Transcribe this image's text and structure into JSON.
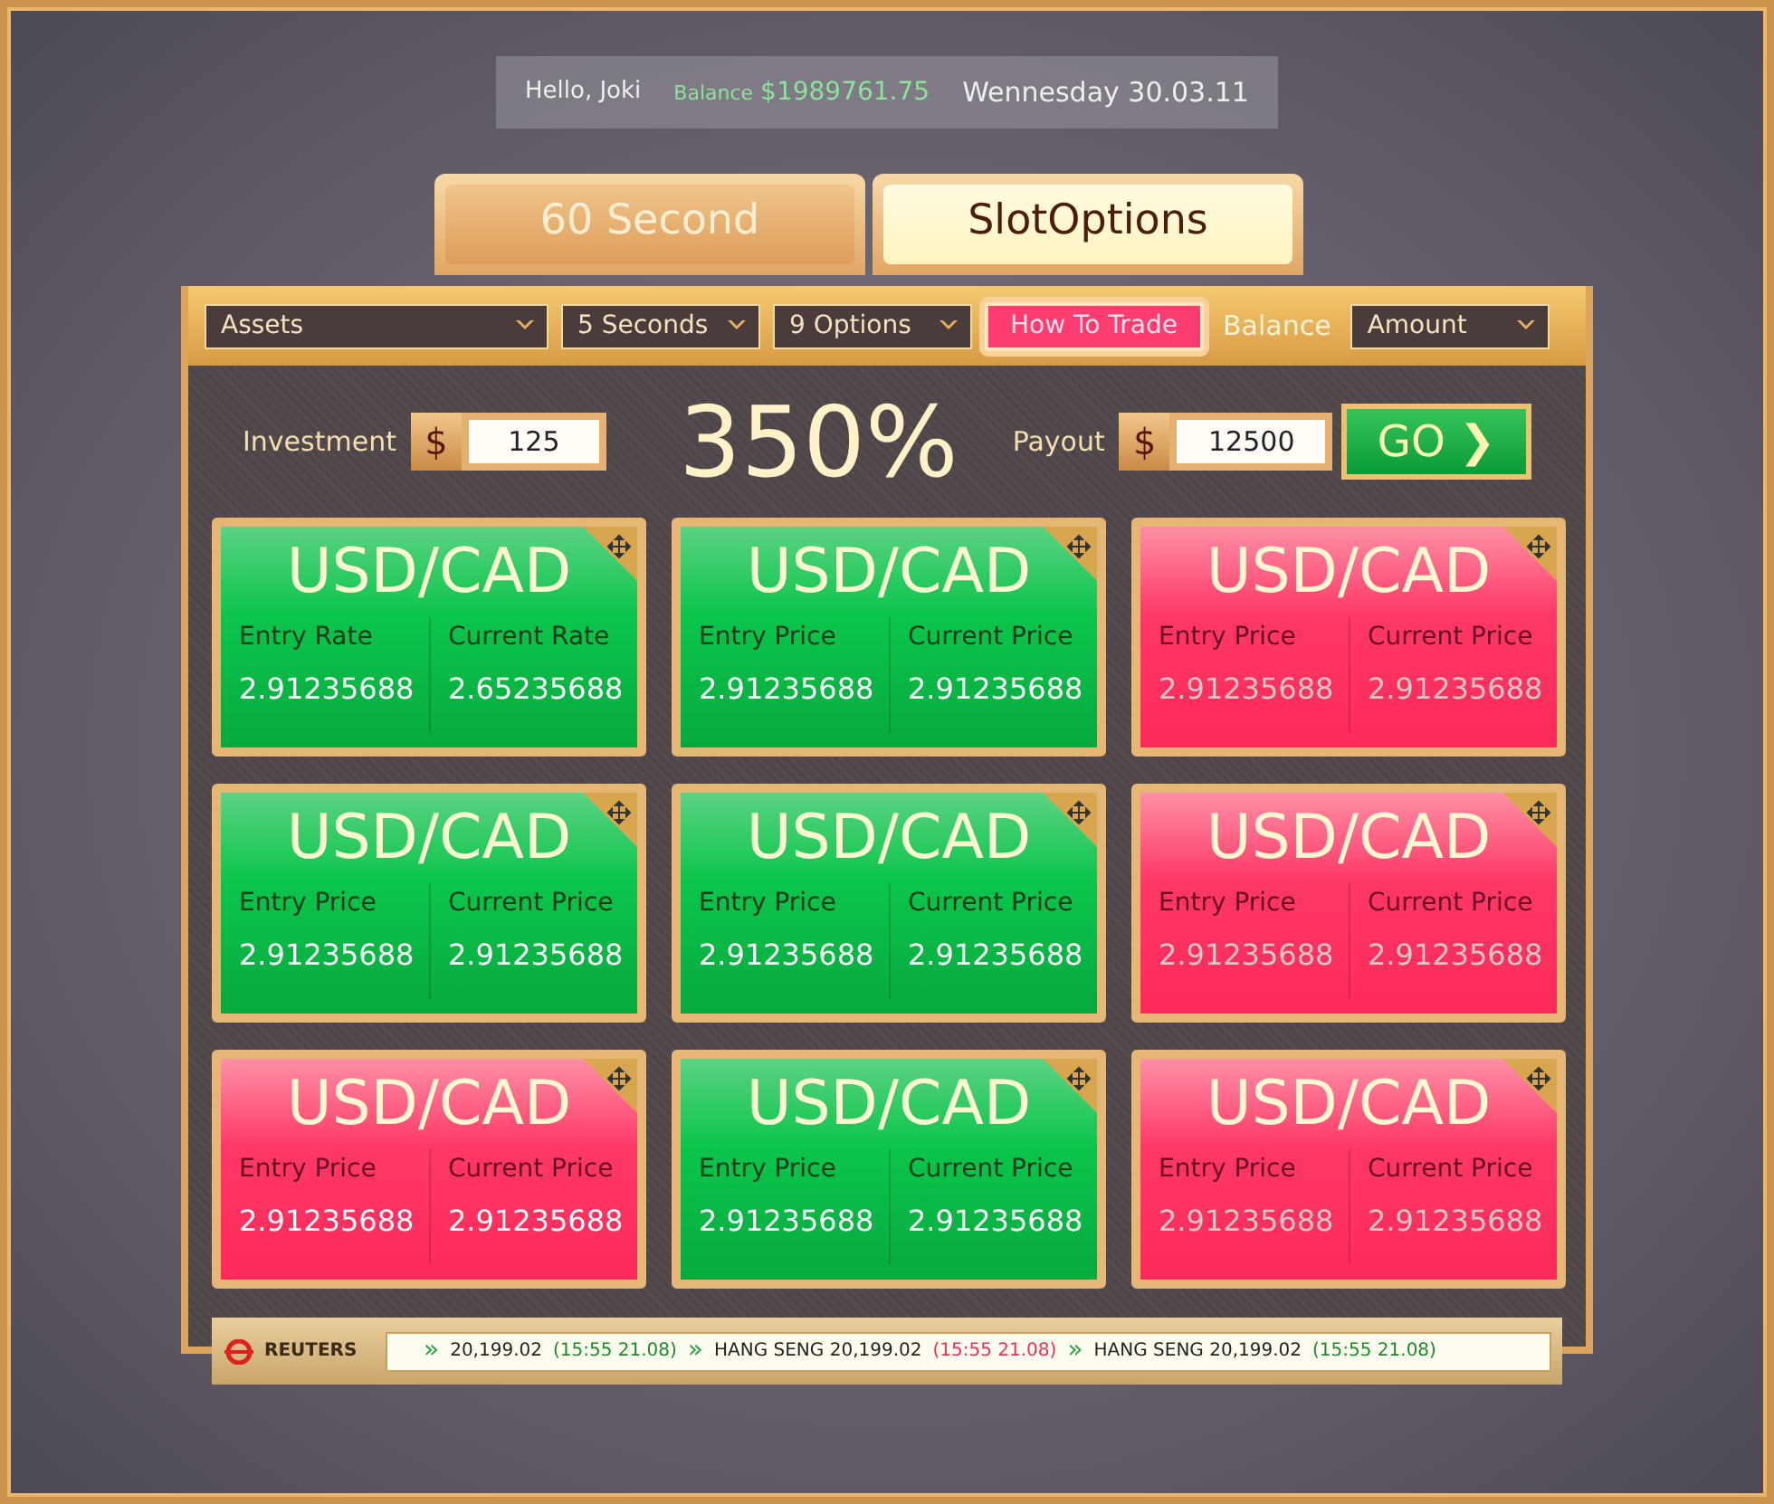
{
  "header": {
    "greeting": "Hello, Joki",
    "balance_label": "Balance",
    "balance": "$1989761.75",
    "date": "Wennesday 30.03.11"
  },
  "tabs": [
    {
      "label": "60 Second",
      "selected": false
    },
    {
      "label": "SlotOptions",
      "selected": true
    }
  ],
  "toolbar": [
    {
      "kind": "dropdown",
      "label": "Assets"
    },
    {
      "kind": "dropdown",
      "label": "5 Seconds"
    },
    {
      "kind": "dropdown",
      "label": "9 Options"
    },
    {
      "kind": "button",
      "label": "How To Trade"
    },
    {
      "kind": "label",
      "label": "Balance"
    },
    {
      "kind": "dropdown",
      "label": "Amount"
    }
  ],
  "trade": {
    "investment_label": "Investment",
    "currency": "$",
    "investment": "125",
    "percent": "350%",
    "payout_label": "Payout",
    "payout_currency": "$",
    "payout": "12500",
    "go": "GO",
    "go_arrow": "❯"
  },
  "tiles": [
    {
      "kind": "up",
      "dimmed": false,
      "pair": "USD/CAD",
      "left_label": "Entry Rate",
      "left_value": "2.91235688",
      "right_label": "Current Rate",
      "right_value": "2.65235688"
    },
    {
      "kind": "up",
      "dimmed": false,
      "pair": "USD/CAD",
      "left_label": "Entry Price",
      "left_value": "2.91235688",
      "right_label": "Current Price",
      "right_value": "2.91235688"
    },
    {
      "kind": "down",
      "dimmed": true,
      "pair": "USD/CAD",
      "left_label": "Entry Price",
      "left_value": "2.91235688",
      "right_label": "Current Price",
      "right_value": "2.91235688"
    },
    {
      "kind": "up",
      "dimmed": false,
      "pair": "USD/CAD",
      "left_label": "Entry Price",
      "left_value": "2.91235688",
      "right_label": "Current Price",
      "right_value": "2.91235688"
    },
    {
      "kind": "up",
      "dimmed": false,
      "pair": "USD/CAD",
      "left_label": "Entry Price",
      "left_value": "2.91235688",
      "right_label": "Current Price",
      "right_value": "2.91235688"
    },
    {
      "kind": "down",
      "dimmed": true,
      "pair": "USD/CAD",
      "left_label": "Entry Price",
      "left_value": "2.91235688",
      "right_label": "Current Price",
      "right_value": "2.91235688"
    },
    {
      "kind": "down",
      "dimmed": false,
      "pair": "USD/CAD",
      "left_label": "Entry Price",
      "left_value": "2.91235688",
      "right_label": "Current Price",
      "right_value": "2.91235688"
    },
    {
      "kind": "up",
      "dimmed": false,
      "pair": "USD/CAD",
      "left_label": "Entry Price",
      "left_value": "2.91235688",
      "right_label": "Current Price",
      "right_value": "2.91235688"
    },
    {
      "kind": "down",
      "dimmed": true,
      "pair": "USD/CAD",
      "left_label": "Entry Price",
      "left_value": "2.91235688",
      "right_label": "Current Price",
      "right_value": "2.91235688"
    }
  ],
  "ticker": {
    "source": "REUTERS",
    "items": [
      {
        "marker": "»",
        "text": "20,199.02",
        "time": "(15:55 21.08)",
        "color": "#1a8a2a"
      },
      {
        "marker": "»",
        "text": "HANG SENG 20,199.02",
        "time": "(15:55 21.08)",
        "color": "#e8305a"
      },
      {
        "marker": "»",
        "text": "HANG SENG 20,199.02",
        "time": "(15:55 21.08)",
        "color": "#1a8a2a"
      }
    ]
  }
}
